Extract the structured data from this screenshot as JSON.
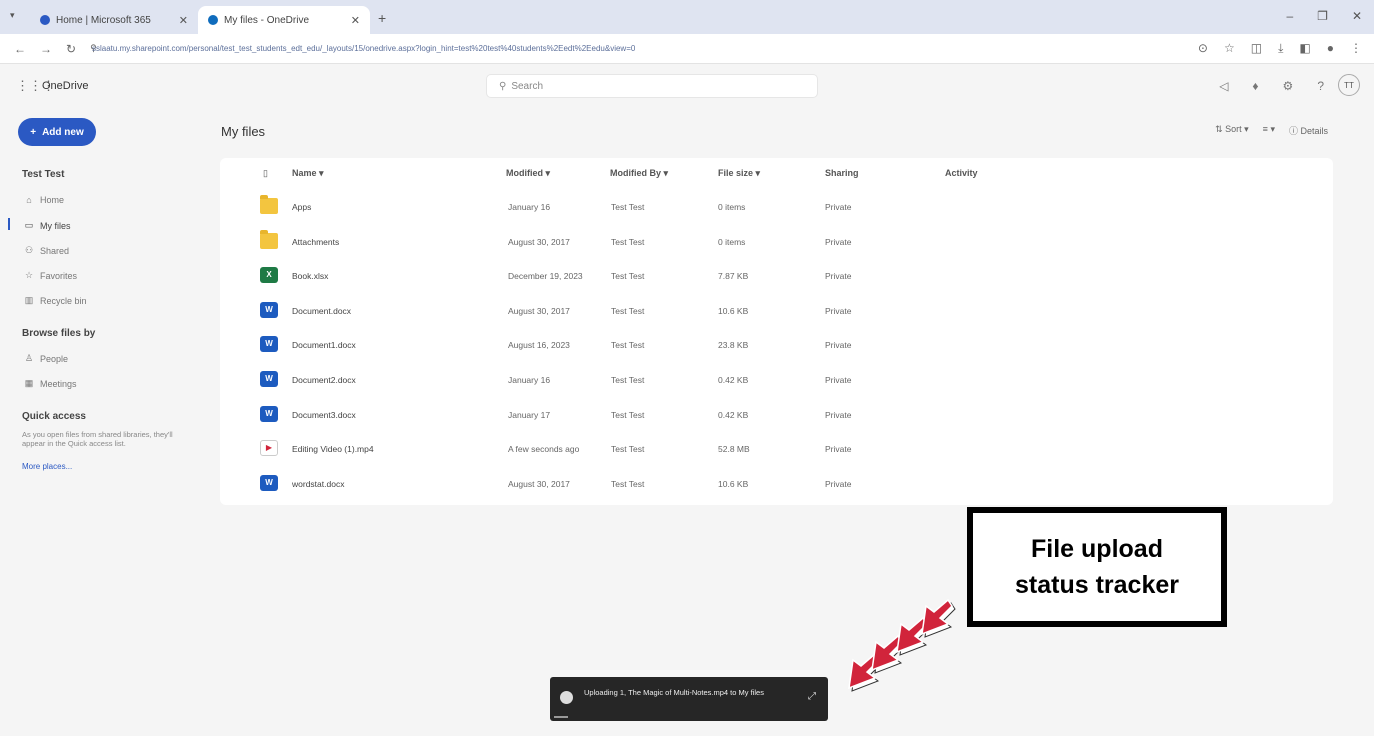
{
  "browser": {
    "tabs": [
      {
        "label": "Home | Microsoft 365"
      },
      {
        "label": "My files - OneDrive"
      }
    ],
    "new_tab": "+",
    "tab_close": "✕",
    "url": "sslaatu.my.sharepoint.com/personal/test_test_students_edt_edu/_layouts/15/onedrive.aspx?login_hint=test%20test%40students%2Eedt%2Eedu&view=0"
  },
  "app": {
    "name": "OneDrive",
    "search_placeholder": "Search",
    "avatar_initials": "TT"
  },
  "sidebar": {
    "add_new_label": "Add new",
    "user_heading": "Test Test",
    "items": [
      {
        "label": "Home",
        "icon": "home-icon"
      },
      {
        "label": "My files",
        "icon": "folder-icon"
      },
      {
        "label": "Shared",
        "icon": "people-icon"
      },
      {
        "label": "Favorites",
        "icon": "star-icon"
      },
      {
        "label": "Recycle bin",
        "icon": "trash-icon"
      }
    ],
    "browse_heading": "Browse files by",
    "browse_items": [
      {
        "label": "People",
        "icon": "person-icon"
      },
      {
        "label": "Meetings",
        "icon": "calendar-icon"
      }
    ],
    "quick_access_heading": "Quick access",
    "quick_access_text": "As you open files from shared libraries, they'll appear in the Quick access list.",
    "quick_access_more": "More places..."
  },
  "main": {
    "title": "My files",
    "commands": {
      "sort": "Sort",
      "view": "≡",
      "details": "Details"
    },
    "columns": {
      "name": "Name",
      "modified": "Modified",
      "modified_by": "Modified By",
      "file_size": "File size",
      "sharing": "Sharing",
      "activity": "Activity"
    },
    "files": [
      {
        "name": "Apps",
        "type": "folder",
        "modified": "January 16",
        "by": "Test Test",
        "size": "0 items",
        "sharing": "Private"
      },
      {
        "name": "Attachments",
        "type": "folder",
        "modified": "August 30, 2017",
        "by": "Test Test",
        "size": "0 items",
        "sharing": "Private"
      },
      {
        "name": "Book.xlsx",
        "type": "excel",
        "modified": "December 19, 2023",
        "by": "Test Test",
        "size": "7.87 KB",
        "sharing": "Private"
      },
      {
        "name": "Document.docx",
        "type": "word",
        "modified": "August 30, 2017",
        "by": "Test Test",
        "size": "10.6 KB",
        "sharing": "Private"
      },
      {
        "name": "Document1.docx",
        "type": "word",
        "modified": "August 16, 2023",
        "by": "Test Test",
        "size": "23.8 KB",
        "sharing": "Private"
      },
      {
        "name": "Document2.docx",
        "type": "word",
        "modified": "January 16",
        "by": "Test Test",
        "size": "0.42 KB",
        "sharing": "Private"
      },
      {
        "name": "Document3.docx",
        "type": "word",
        "modified": "January 17",
        "by": "Test Test",
        "size": "0.42 KB",
        "sharing": "Private"
      },
      {
        "name": "Editing Video (1).mp4",
        "type": "video",
        "modified": "A few seconds ago",
        "by": "Test Test",
        "size": "52.8 MB",
        "sharing": "Private"
      },
      {
        "name": "wordstat.docx",
        "type": "word",
        "modified": "August 30, 2017",
        "by": "Test Test",
        "size": "10.6 KB",
        "sharing": "Private"
      }
    ]
  },
  "callout": {
    "text": "File upload status tracker"
  },
  "toast": {
    "text": "Uploading 1, The Magic of Multi-Notes.mp4 to My files"
  },
  "colors": {
    "accent": "#2b59c3",
    "callout_arrow": "#d1243b"
  }
}
